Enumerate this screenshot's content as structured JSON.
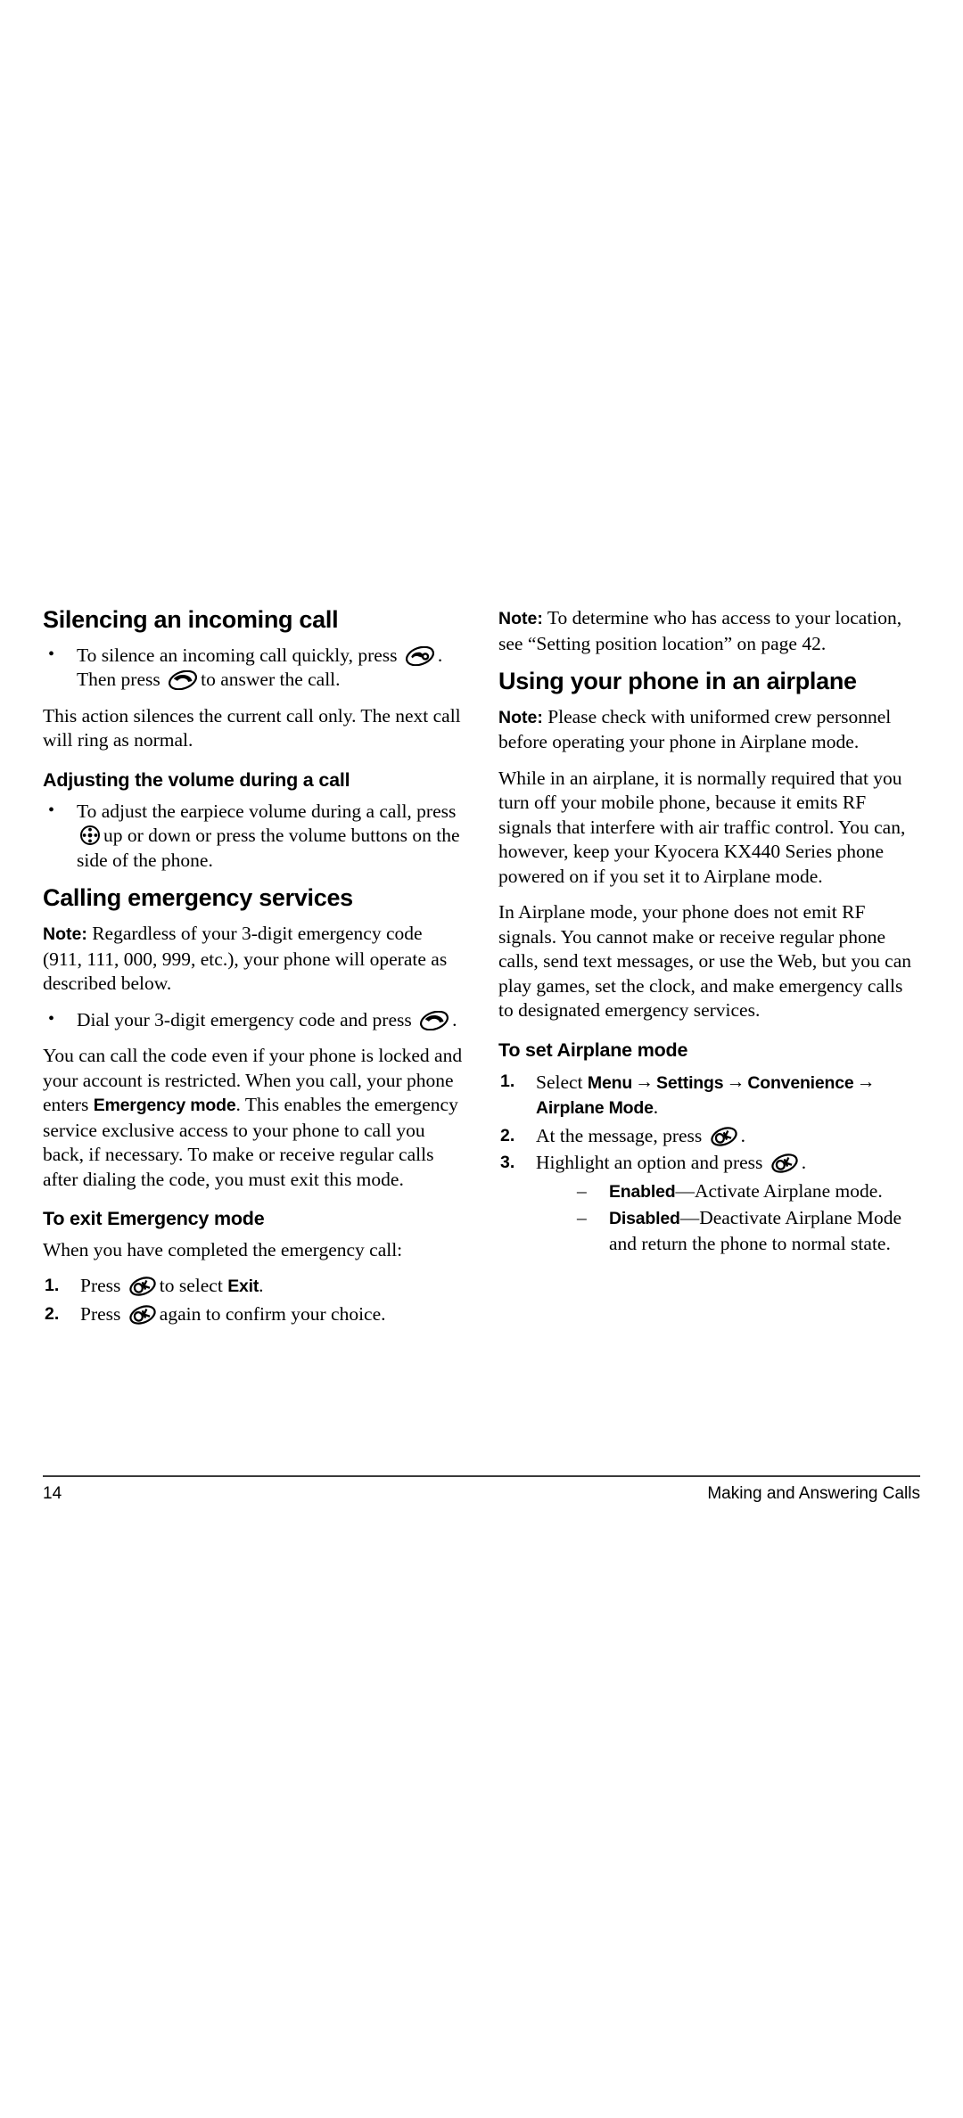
{
  "document": {
    "page_number": "14",
    "footer_title": "Making and Answering Calls"
  },
  "left_column": {
    "heading_silencing": "Silencing an incoming call",
    "bullet_silence_part1": "To silence an incoming call quickly, press",
    "bullet_silence_part2": ". Then press",
    "bullet_silence_part3": "to answer the call.",
    "para_silences": "This action silences the current call only. The next call will ring as normal.",
    "heading_volume": "Adjusting the volume during a call",
    "bullet_volume_part1": "To adjust the earpiece volume during a call, press",
    "bullet_volume_part2": "up or down or press the volume buttons on the side of the phone.",
    "heading_emergency": "Calling emergency services",
    "note_label": "Note:",
    "note_emergency": "Regardless of your 3-digit emergency code (911, 111, 000, 999, etc.), your phone will operate as described below.",
    "bullet_dial_part1": "Dial your 3-digit emergency code and press",
    "bullet_dial_part2": ".",
    "para_locked_1": "You can call the code even if your phone is locked and your account is restricted. When you call, your phone enters ",
    "emergency_mode_bold": "Emergency mode",
    "para_locked_2": ". This enables the emergency service exclusive access to your phone to call you back, if necessary. To make or receive regular calls after dialing the code, you must exit this mode.",
    "heading_exit": "To exit Emergency mode",
    "para_when_completed": "When you have completed the emergency call:",
    "step1_pre": "Press",
    "step1_mid": "to select",
    "step1_bold": "Exit",
    "step1_post": ".",
    "step2_pre": "Press",
    "step2_post": "again to confirm your choice."
  },
  "right_column": {
    "note_label": "Note:",
    "note_position": "To determine who has access to your location, see “Setting position location” on page 42.",
    "heading_airplane": "Using your phone in an airplane",
    "note_uniformed": "Please check with uniformed crew personnel before operating your phone in Airplane mode.",
    "para_while_airplane": "While in an airplane, it is normally required that you turn off your mobile phone, because it emits RF signals that interfere with air traffic control. You can, however, keep your Kyocera KX440 Series phone powered on if you set it to Airplane mode.",
    "para_in_airplane_mode": "In Airplane mode, your phone does not emit RF signals. You cannot make or receive regular phone calls, send text messages, or use the Web, but you can play games, set the clock, and make emergency calls to designated emergency services.",
    "heading_set_airplane": "To set Airplane mode",
    "step1_pre": "Select",
    "step1_menu": "Menu",
    "step1_arrow": "→",
    "step1_settings": "Settings",
    "step1_convenience": "Convenience",
    "step1_airplane": "Airplane Mode",
    "step1_period": ".",
    "step2_pre": "At the message, press",
    "step2_post": ".",
    "step3_pre": "Highlight an option and press",
    "step3_post": ".",
    "option_enabled_bold": "Enabled",
    "option_enabled_text": "—Activate Airplane mode.",
    "option_disabled_bold": "Disabled",
    "option_disabled_text": "—Deactivate Airplane Mode and return the phone to normal state."
  },
  "icons": {
    "end_key": "end-call-key-icon",
    "send_key": "send-call-key-icon",
    "nav_key": "navigation-key-icon",
    "ok_key": "ok-key-icon"
  },
  "colors": {
    "text": "#000000",
    "background": "#ffffff",
    "rule": "#3a3a3a"
  }
}
